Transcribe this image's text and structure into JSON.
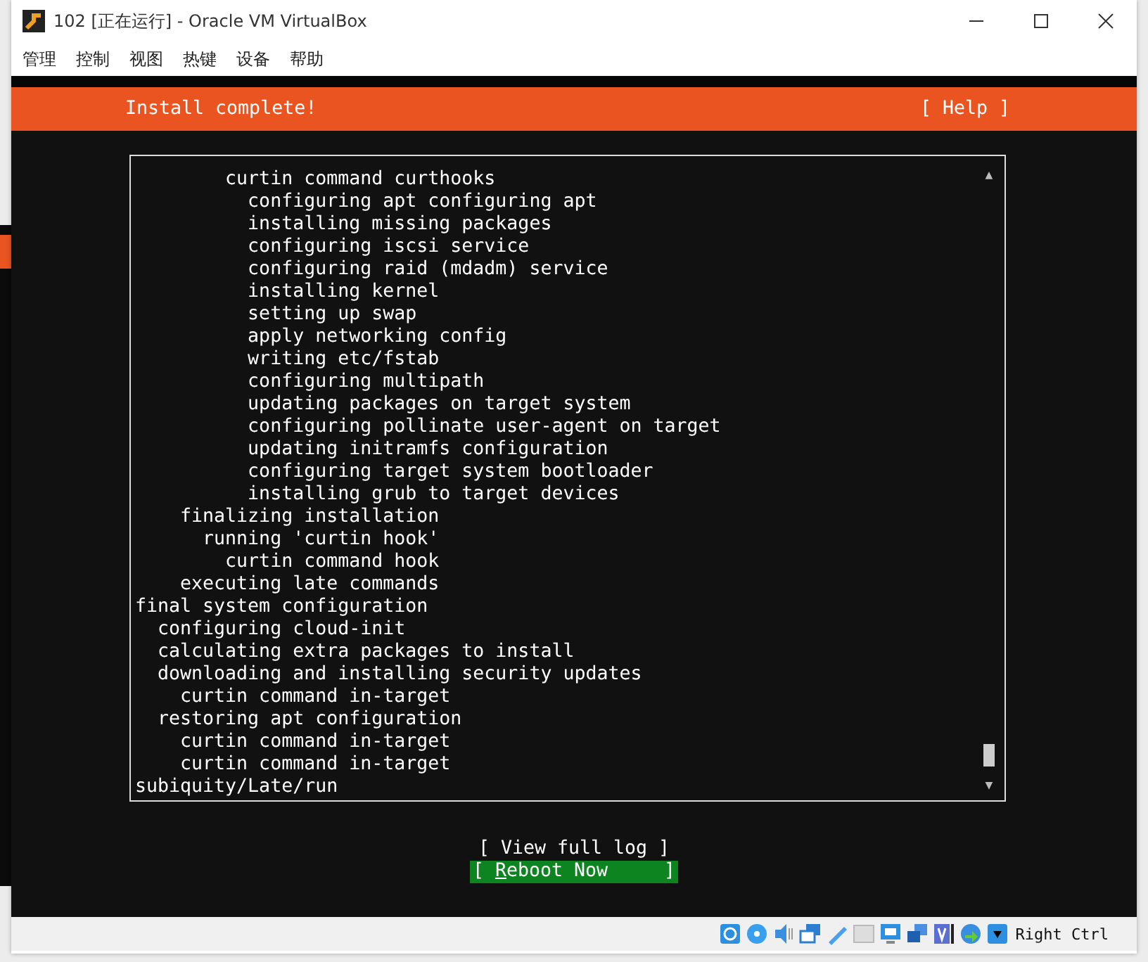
{
  "window": {
    "title": "102 [正在运行] - Oracle VM VirtualBox"
  },
  "menu": [
    "管理",
    "控制",
    "视图",
    "热键",
    "设备",
    "帮助"
  ],
  "header": {
    "title": "Install complete!",
    "help": "[ Help ]"
  },
  "log": {
    "lines": [
      "        curtin command curthooks",
      "          configuring apt configuring apt",
      "          installing missing packages",
      "          configuring iscsi service",
      "          configuring raid (mdadm) service",
      "          installing kernel",
      "          setting up swap",
      "          apply networking config",
      "          writing etc/fstab",
      "          configuring multipath",
      "          updating packages on target system",
      "          configuring pollinate user-agent on target",
      "          updating initramfs configuration",
      "          configuring target system bootloader",
      "          installing grub to target devices",
      "    finalizing installation",
      "      running 'curtin hook'",
      "        curtin command hook",
      "    executing late commands",
      "final system configuration",
      "  configuring cloud-init",
      "  calculating extra packages to install",
      "  downloading and installing security updates",
      "    curtin command in-target",
      "  restoring apt configuration",
      "    curtin command in-target",
      "    curtin command in-target",
      "subiquity/Late/run"
    ],
    "scroll_up": "▲",
    "scroll_down": "▼"
  },
  "buttons": [
    {
      "label": "[ View full log ]",
      "selected": false
    },
    {
      "label": "[ Reboot Now     ]",
      "selected": true
    }
  ],
  "status_bar": {
    "host_key": "Right Ctrl"
  }
}
